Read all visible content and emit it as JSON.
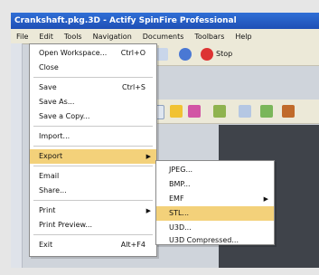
{
  "window": {
    "title": "Crankshaft.pkg.3D - Actify SpinFire Professional"
  },
  "menubar": {
    "items": [
      "File",
      "Edit",
      "Tools",
      "Navigation",
      "Documents",
      "Toolbars",
      "Help"
    ]
  },
  "toolbar": {
    "stop_label": "Stop"
  },
  "file_menu": {
    "items": [
      {
        "label": "Open Workspace...",
        "shortcut": "Ctrl+O"
      },
      {
        "label": "Close",
        "shortcut": ""
      },
      {
        "label": "Save",
        "shortcut": "Ctrl+S"
      },
      {
        "label": "Save As...",
        "shortcut": ""
      },
      {
        "label": "Save a Copy...",
        "shortcut": ""
      },
      {
        "label": "Import...",
        "shortcut": ""
      },
      {
        "label": "Export",
        "shortcut": ""
      },
      {
        "label": "Email",
        "shortcut": ""
      },
      {
        "label": "Share...",
        "shortcut": ""
      },
      {
        "label": "Print",
        "shortcut": ""
      },
      {
        "label": "Print Preview...",
        "shortcut": ""
      },
      {
        "label": "Exit",
        "shortcut": "Alt+F4"
      }
    ]
  },
  "export_submenu": {
    "items": [
      {
        "label": "JPEG..."
      },
      {
        "label": "BMP..."
      },
      {
        "label": "EMF"
      },
      {
        "label": "STL..."
      },
      {
        "label": "U3D..."
      },
      {
        "label": "U3D Compressed..."
      }
    ]
  },
  "colors": {
    "title_blue": "#1f4fb5",
    "highlight": "#f3d17a",
    "menu_bg": "#ece9d8"
  }
}
